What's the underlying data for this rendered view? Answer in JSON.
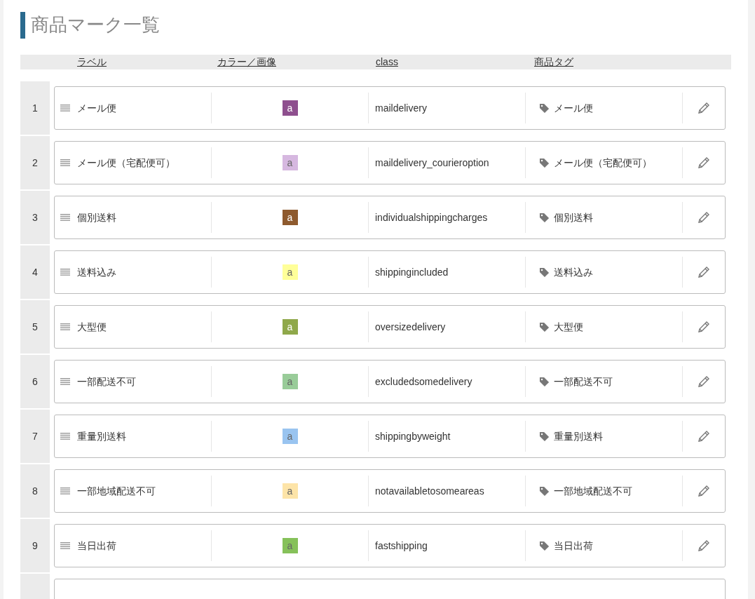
{
  "title": "商品マーク一覧",
  "columns": [
    "ラベル",
    "カラー／画像",
    "class",
    "商品タグ"
  ],
  "rows": [
    {
      "number": "1",
      "label": "メール便",
      "swatch_text": "a",
      "color": "#8e4f8e",
      "class": "maildelivery",
      "tag": "メール便"
    },
    {
      "number": "2",
      "label": "メール便（宅配便可）",
      "swatch_text": "a",
      "color": "#d6b8e0",
      "class": "maildelivery_courieroption",
      "tag": "メール便（宅配便可）"
    },
    {
      "number": "3",
      "label": "個別送料",
      "swatch_text": "a",
      "color": "#8e5a2e",
      "class": "individualshippingcharges",
      "tag": "個別送料"
    },
    {
      "number": "4",
      "label": "送料込み",
      "swatch_text": "a",
      "color": "#ffff99",
      "class": "shippingincluded",
      "tag": "送料込み"
    },
    {
      "number": "5",
      "label": "大型便",
      "swatch_text": "a",
      "color": "#8fa84a",
      "class": "oversizedelivery",
      "tag": "大型便"
    },
    {
      "number": "6",
      "label": "一部配送不可",
      "swatch_text": "a",
      "color": "#99cc99",
      "class": "excludedsomedelivery",
      "tag": "一部配送不可"
    },
    {
      "number": "7",
      "label": "重量別送料",
      "swatch_text": "a",
      "color": "#99c4f0",
      "class": "shippingbyweight",
      "tag": "重量別送料"
    },
    {
      "number": "8",
      "label": "一部地域配送不可",
      "swatch_text": "a",
      "color": "#fde4a8",
      "class": "notavailabletosomeareas",
      "tag": "一部地域配送不可"
    },
    {
      "number": "9",
      "label": "当日出荷",
      "swatch_text": "a",
      "color": "#86c15a",
      "class": "fastshipping",
      "tag": "当日出荷"
    }
  ]
}
